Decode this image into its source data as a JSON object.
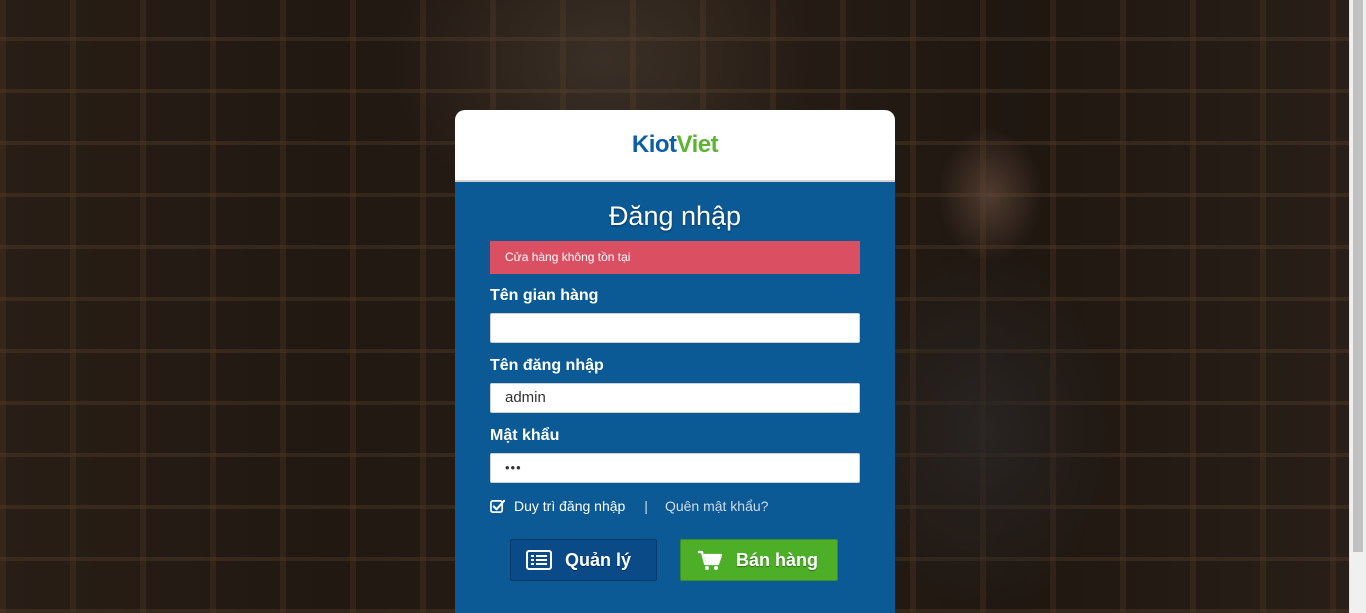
{
  "brand": {
    "part1": "Kiot",
    "part2": "Viet"
  },
  "title": "Đăng nhập",
  "alert": "Cửa hàng không tồn tại",
  "fields": {
    "store": {
      "label": "Tên gian hàng",
      "value": ""
    },
    "username": {
      "label": "Tên đăng nhập",
      "value": "admin"
    },
    "password": {
      "label": "Mật khẩu",
      "value": "•••"
    }
  },
  "remember_label": "Duy trì đăng nhập",
  "separator": "|",
  "forgot_label": "Quên mật khẩu?",
  "buttons": {
    "manage": "Quản lý",
    "sell": "Bán hàng"
  },
  "icons": {
    "manage": "list-icon",
    "sell": "cart-icon",
    "remember": "checkbox-checked-icon"
  },
  "colors": {
    "panel": "#0b5a96",
    "alert": "#db4f63",
    "manage_button": "#0a4a86",
    "sell_button": "#4caf27",
    "logo_blue": "#0b5fa5",
    "logo_green": "#5cb531"
  }
}
